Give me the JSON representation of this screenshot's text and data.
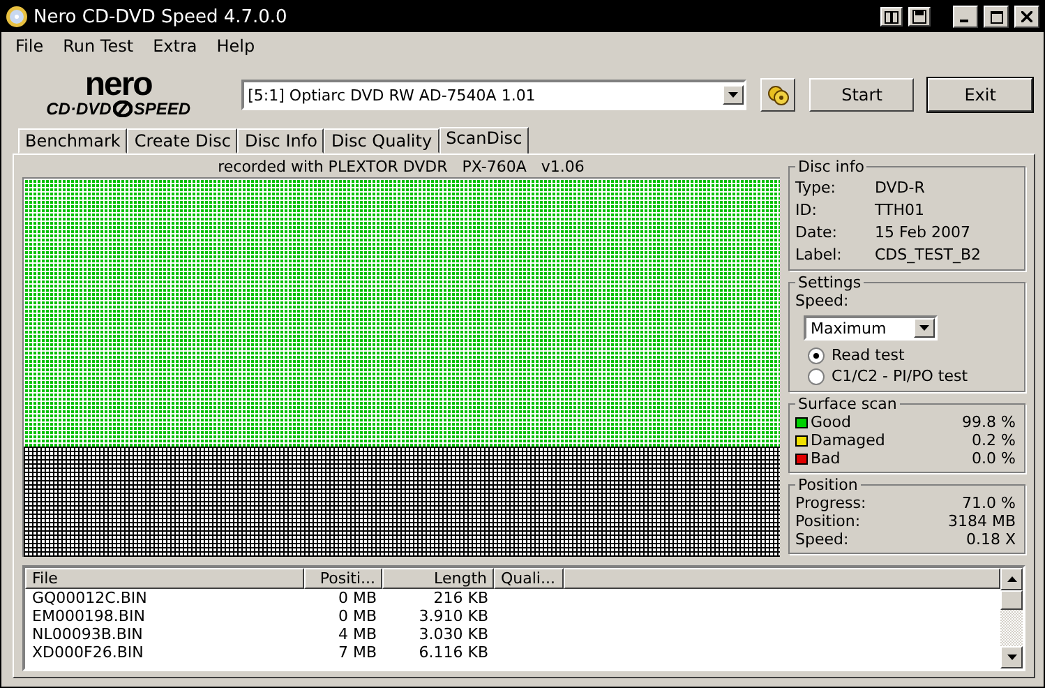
{
  "window": {
    "title": "Nero CD-DVD Speed 4.7.0.0"
  },
  "menu": [
    "File",
    "Run Test",
    "Extra",
    "Help"
  ],
  "logo": {
    "brand": "nero",
    "product": "CD·DVD",
    "product2": "SPEED"
  },
  "drive": {
    "value": "[5:1]  Optiarc DVD RW AD-7540A 1.01"
  },
  "buttons": [
    {
      "label": "Start",
      "selected": false
    },
    {
      "label": "Exit",
      "selected": true
    }
  ],
  "tabs": [
    {
      "label": "Benchmark",
      "selected": false
    },
    {
      "label": "Create Disc",
      "selected": false
    },
    {
      "label": "Disc Info",
      "selected": false
    },
    {
      "label": "Disc Quality",
      "selected": false
    },
    {
      "label": "ScanDisc",
      "selected": true
    }
  ],
  "recorded_with": "recorded with PLEXTOR DVDR   PX-760A   v1.06",
  "disc_info": {
    "title": "Disc info",
    "rows": [
      {
        "label": "Type:",
        "value": "DVD-R"
      },
      {
        "label": "ID:",
        "value": "TTH01"
      },
      {
        "label": "Date:",
        "value": "15 Feb 2007"
      },
      {
        "label": "Label:",
        "value": "CDS_TEST_B2"
      }
    ]
  },
  "settings": {
    "title": "Settings",
    "speed_label": "Speed:",
    "speed": "Maximum",
    "options": [
      {
        "label": "Read test",
        "selected": true
      },
      {
        "label": "C1/C2 - PI/PO test",
        "selected": false
      }
    ]
  },
  "surface_scan": {
    "title": "Surface scan",
    "rows": [
      {
        "label": "Good",
        "value": "99.8 %",
        "color": "#00d000"
      },
      {
        "label": "Damaged",
        "value": "0.2 %",
        "color": "#f0e000"
      },
      {
        "label": "Bad",
        "value": "0.0 %",
        "color": "#e00000"
      }
    ]
  },
  "position": {
    "title": "Position",
    "rows": [
      {
        "label": "Progress:",
        "value": "71.0 %"
      },
      {
        "label": "Position:",
        "value": "3184 MB"
      },
      {
        "label": "Speed:",
        "value": "0.18 X"
      }
    ]
  },
  "files": {
    "columns": [
      "File",
      "Positi...",
      "Length",
      "Quali..."
    ],
    "rows": [
      [
        "GQ00012C.BIN",
        "0 MB",
        "216 KB"
      ],
      [
        "EM000198.BIN",
        "0 MB",
        "3.910 KB"
      ],
      [
        "NL00093B.BIN",
        "4 MB",
        "3.030 KB"
      ],
      [
        "XD000F26.BIN",
        "7 MB",
        "6.116 KB"
      ]
    ]
  }
}
